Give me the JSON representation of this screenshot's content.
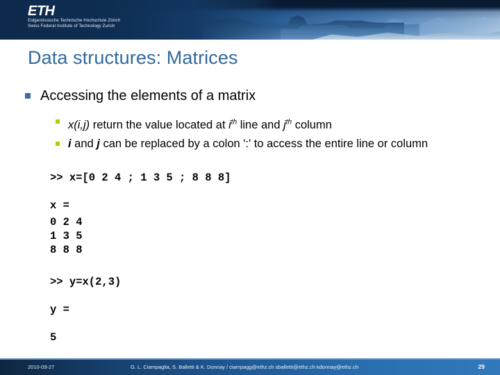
{
  "header": {
    "logo_word": "ETH",
    "logo_line1": "Eidgenössische Technische Hochschule Zürich",
    "logo_line2": "Swiss Federal Institute of Technology Zurich",
    "banner_image_alt": "eth-main-building-panorama"
  },
  "slide": {
    "title": "Data structures: Matrices",
    "bullet1": "Accessing the elements of a matrix",
    "sub_bullets": [
      {
        "id": "sub-bullet-xij",
        "parts": [
          {
            "text": "x(i,j)",
            "style": "italic"
          },
          {
            "text": " return the value located at ",
            "style": "normal"
          },
          {
            "text": "i",
            "style": "italic"
          },
          {
            "text": "th",
            "style": "superscript"
          },
          {
            "text": " line and ",
            "style": "normal"
          },
          {
            "text": "j",
            "style": "italic"
          },
          {
            "text": "th",
            "style": "superscript"
          },
          {
            "text": " column",
            "style": "normal"
          }
        ],
        "plain": "x(i,j) return the value located at ith line and jth column"
      },
      {
        "id": "sub-bullet-colon",
        "parts": [
          {
            "text": "i",
            "style": "bold-italic"
          },
          {
            "text": " and ",
            "style": "normal"
          },
          {
            "text": "j",
            "style": "bold-italic"
          },
          {
            "text": " can be replaced by a colon ':'  to access the entire line or column",
            "style": "normal"
          }
        ],
        "plain": "i and j can be replaced by a colon ':'  to access the entire line or column"
      }
    ],
    "code": {
      "command1": ">> x=[0 2 4 ; 1 3 5 ; 8 8 8]",
      "output1_label": "x =",
      "output1_rows": [
        "0 2 4",
        "1 3 5",
        "8 8 8"
      ],
      "command2": ">> y=x(2,3)",
      "output2_label": "y =",
      "output2_value": "5"
    }
  },
  "footer": {
    "date": "2010-09-27",
    "authors": "G. L. Ciampaglia, S. Balletti & K. Donnay /  ciampagg@ethz.ch  sballetti@ethz.ch  kdonnay@ethz.ch",
    "page_number": "29"
  },
  "colors": {
    "title_blue": "#31699e",
    "bullet1_marker": "#3a6ea5",
    "bullet2_marker": "#b6c900",
    "header_dark": "#0d2a4a",
    "footer_gradient_start": "#0e2540",
    "footer_gradient_end": "#3179bb"
  }
}
